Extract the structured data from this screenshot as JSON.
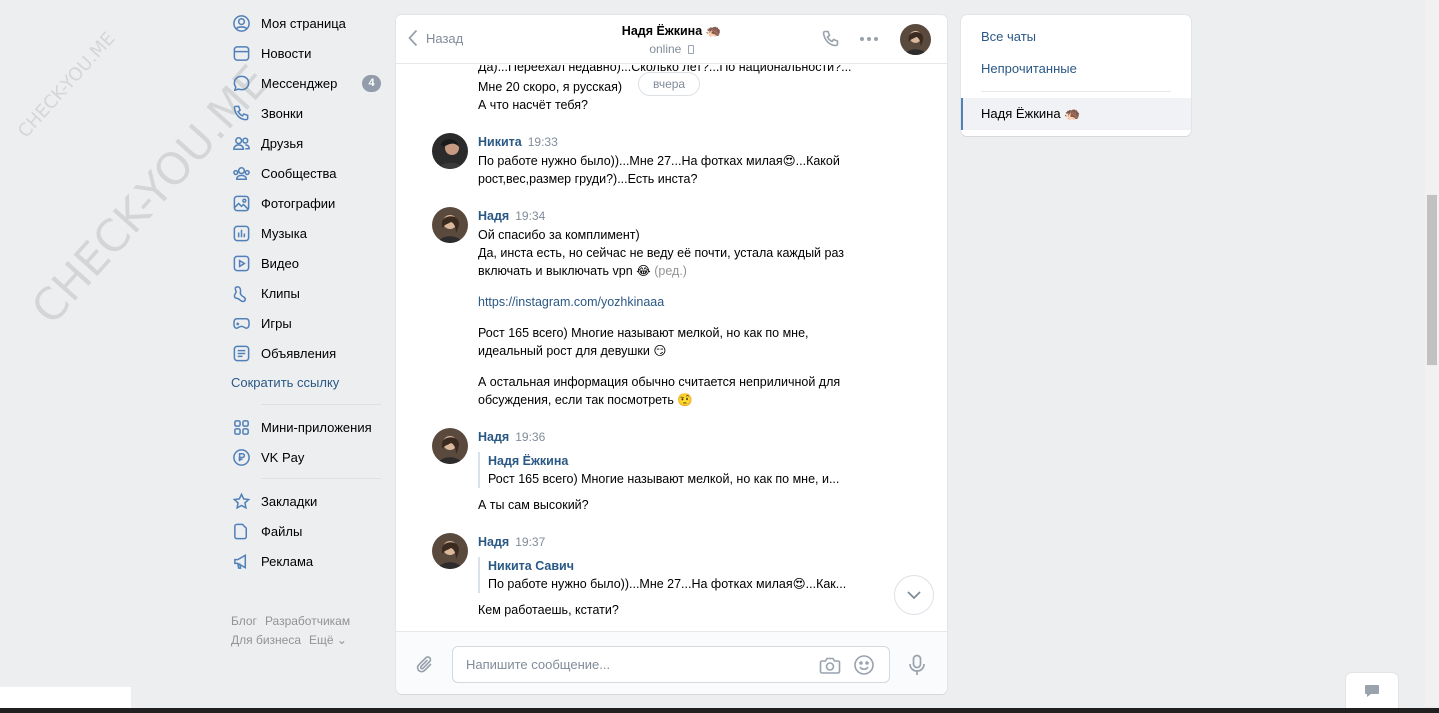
{
  "watermark": {
    "small": "CHECK-YOU.ME",
    "large": "CHECK-YOU.ME"
  },
  "sidebar": {
    "items": [
      {
        "label": "Моя страница",
        "icon": "user-circle-icon"
      },
      {
        "label": "Новости",
        "icon": "news-icon"
      },
      {
        "label": "Мессенджер",
        "icon": "message-icon",
        "badge": "4"
      },
      {
        "label": "Звонки",
        "icon": "phone-icon"
      },
      {
        "label": "Друзья",
        "icon": "friends-icon"
      },
      {
        "label": "Сообщества",
        "icon": "communities-icon"
      },
      {
        "label": "Фотографии",
        "icon": "photo-icon"
      },
      {
        "label": "Музыка",
        "icon": "music-icon"
      },
      {
        "label": "Видео",
        "icon": "video-icon"
      },
      {
        "label": "Клипы",
        "icon": "clips-icon"
      },
      {
        "label": "Игры",
        "icon": "gamepad-icon"
      },
      {
        "label": "Объявления",
        "icon": "classifieds-icon"
      }
    ],
    "shorten_link": "Сократить ссылку",
    "items2": [
      {
        "label": "Мини-приложения",
        "icon": "apps-icon"
      },
      {
        "label": "VK Pay",
        "icon": "vkpay-icon"
      }
    ],
    "items3": [
      {
        "label": "Закладки",
        "icon": "star-icon"
      },
      {
        "label": "Файлы",
        "icon": "file-icon"
      },
      {
        "label": "Реклама",
        "icon": "megaphone-icon"
      }
    ],
    "footer": {
      "blog": "Блог",
      "dev": "Разработчикам",
      "business": "Для бизнеса",
      "more": "Ещё ⌄"
    }
  },
  "chat": {
    "back_label": "Назад",
    "contact_name": "Надя Ёжкина 🦔",
    "status": "online",
    "date_pill": "вчера",
    "top_partial": "Да)...Переехал недавно)...Сколько лет?...По национальности?...",
    "top_lines": [
      "Мне 20 скоро, я русская)",
      "А что насчёт тебя?"
    ],
    "m1": {
      "author": "Никита",
      "time": "19:33",
      "lines": [
        "По работе нужно было))...Мне 27...На фотках милая😍...Какой",
        "рост,вес,размер груди?)...Есть инста?"
      ]
    },
    "m2": {
      "author": "Надя",
      "time": "19:34",
      "l1": "Ой спасибо за комплимент)",
      "l2": "Да, инста есть, но сейчас не веду её почти, устала каждый раз",
      "l3": "включать и выключать vpn 😂",
      "edited": "(ред.)",
      "link": "https://instagram.com/yozhkinaaa",
      "l4": "Рост 165 всего) Многие называют мелкой, но как по мне,",
      "l5": "идеальный рост для девушки 😏",
      "l6": "А остальная информация обычно считается неприличной для",
      "l7": "обсуждения, если так посмотреть 🤨"
    },
    "m3": {
      "author": "Надя",
      "time": "19:36",
      "fwd_author": "Надя Ёжкина",
      "fwd_text": "Рост 165 всего) Многие называют мелкой, но как по мне, и...",
      "text": "А ты сам высокий?"
    },
    "m4": {
      "author": "Надя",
      "time": "19:37",
      "fwd_author": "Никита Савич",
      "fwd_text": "По работе нужно было))...Мне 27...На фотках милая😍...Как...",
      "text": "Кем работаешь, кстати?"
    },
    "input_placeholder": "Напишите сообщение..."
  },
  "right_panel": {
    "all_chats": "Все чаты",
    "unread": "Непрочитанные",
    "active_chat": "Надя Ёжкина 🦔"
  },
  "colors": {
    "link": "#2a5885",
    "muted": "#818c99",
    "bg": "#edeef0",
    "accent": "#5181b8"
  }
}
